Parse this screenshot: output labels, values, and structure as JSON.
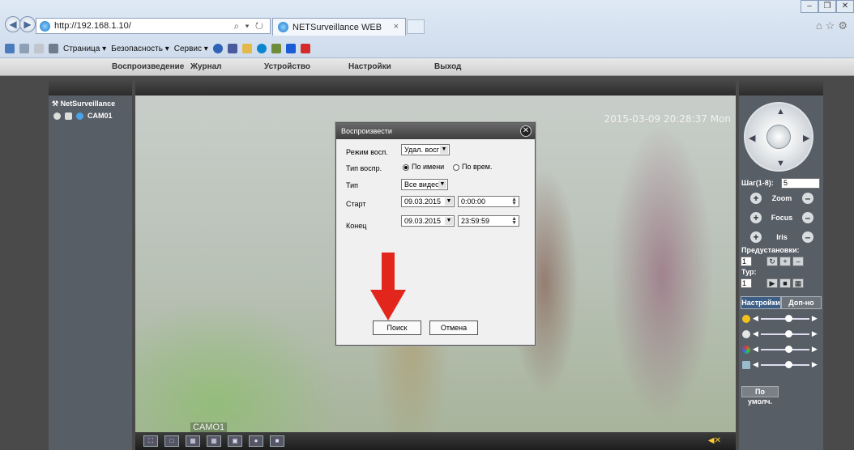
{
  "browser": {
    "url": "http://192.168.1.10/",
    "tab_title": "NETSurveillance WEB",
    "commands": [
      "Страница ▾",
      "Безопасность ▾",
      "Сервис ▾"
    ]
  },
  "menu": {
    "items": [
      "Воспроизведение",
      "Журнал",
      "Устройство",
      "Настройки",
      "Выход"
    ]
  },
  "left": {
    "root_label": "NetSurveillance",
    "camera_label": "CAM01"
  },
  "video": {
    "timestamp": "2015-03-09 20:28:37 Mon",
    "camera_overlay": "CAMO1"
  },
  "dialog": {
    "title": "Воспроизвести",
    "mode_label": "Режим восп.",
    "mode_value": "Удал. восг",
    "type_label": "Тип воспр.",
    "radio_by_name": "По имени",
    "radio_by_time": "По врем.",
    "kind_label": "Тип",
    "kind_value": "Все видео",
    "start_label": "Старт",
    "start_date": "09.03.2015",
    "start_time": "0:00:00",
    "end_label": "Конец",
    "end_date": "09.03.2015",
    "end_time": "23:59:59",
    "search_button": "Поиск",
    "cancel_button": "Отмена"
  },
  "right": {
    "step_label": "Шаг(1-8):",
    "step_value": "5",
    "zoom_label": "Zoom",
    "focus_label": "Focus",
    "iris_label": "Iris",
    "presets_label": "Предустановки:",
    "preset_value": "1",
    "tour_label": "Тур:",
    "tour_value": "1",
    "tab_settings": "Настройки",
    "tab_extra": "Доп-но",
    "default_button": "По умолч."
  },
  "colors": {
    "arrow": "#e3261b",
    "accent_blue": "#3d5f86"
  }
}
